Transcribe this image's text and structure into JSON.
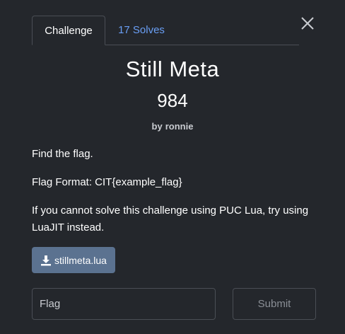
{
  "tabs": {
    "challenge_label": "Challenge",
    "solves_label": "17 Solves"
  },
  "close": {
    "icon": "close-icon"
  },
  "challenge": {
    "name": "Still Meta",
    "value": "984",
    "author_prefix": "by",
    "author": "ronnie",
    "description": [
      "Find the flag.",
      "Flag Format: CIT{example_flag}",
      "If you cannot solve this challenge using PUC Lua, try using LuaJIT instead."
    ]
  },
  "file": {
    "icon": "download-icon",
    "label": "stillmeta.lua"
  },
  "form": {
    "flag_placeholder": "Flag",
    "submit_label": "Submit"
  },
  "colors": {
    "background": "#24272c",
    "tab_link": "#6a9ff5",
    "file_button": "#5b7290",
    "border": "#4a4e55"
  }
}
